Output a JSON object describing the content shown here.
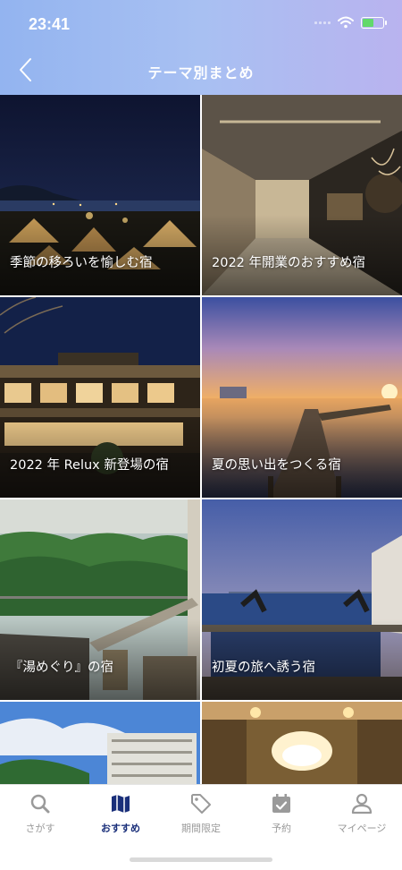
{
  "status_bar": {
    "time": "23:41"
  },
  "header": {
    "title": "テーマ別まとめ"
  },
  "tiles": [
    {
      "label": "季節の移ろいを愉しむ宿"
    },
    {
      "label": "2022 年開業のおすすめ宿"
    },
    {
      "label": "2022 年 Relux 新登場の宿"
    },
    {
      "label": "夏の思い出をつくる宿"
    },
    {
      "label": "『湯めぐり』の宿"
    },
    {
      "label": "初夏の旅へ誘う宿"
    },
    {
      "label": ""
    },
    {
      "label": ""
    }
  ],
  "tabbar": {
    "items": [
      {
        "label": "さがす",
        "icon": "search-icon"
      },
      {
        "label": "おすすめ",
        "icon": "map-icon"
      },
      {
        "label": "期間限定",
        "icon": "tag-icon"
      },
      {
        "label": "予約",
        "icon": "calendar-check-icon"
      },
      {
        "label": "マイページ",
        "icon": "person-icon"
      }
    ],
    "active_index": 1
  },
  "colors": {
    "accent": "#1a2f7a",
    "header_start": "#93b4f0",
    "header_end": "#b9b3ef"
  }
}
